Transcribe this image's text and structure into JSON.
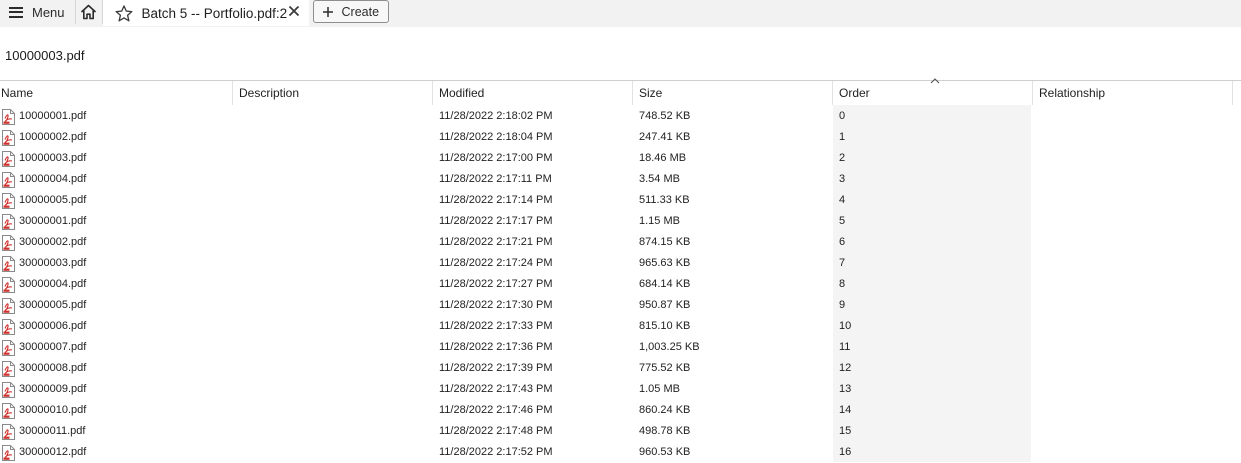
{
  "topbar": {
    "menu_label": "Menu",
    "tab_title": "Batch 5 -- Portfolio.pdf:2",
    "create_label": "Create"
  },
  "current_file": "10000003.pdf",
  "columns": {
    "name": "Name",
    "description": "Description",
    "modified": "Modified",
    "size": "Size",
    "order": "Order",
    "relationship": "Relationship"
  },
  "sort": {
    "column": "Order",
    "direction": "ascending"
  },
  "rows": [
    {
      "name": "10000001.pdf",
      "description": "",
      "modified": "11/28/2022 2:18:02 PM",
      "size": "748.52 KB",
      "order": "0",
      "relationship": ""
    },
    {
      "name": "10000002.pdf",
      "description": "",
      "modified": "11/28/2022 2:18:04 PM",
      "size": "247.41 KB",
      "order": "1",
      "relationship": ""
    },
    {
      "name": "10000003.pdf",
      "description": "",
      "modified": "11/28/2022 2:17:00 PM",
      "size": "18.46 MB",
      "order": "2",
      "relationship": ""
    },
    {
      "name": "10000004.pdf",
      "description": "",
      "modified": "11/28/2022 2:17:11 PM",
      "size": "3.54 MB",
      "order": "3",
      "relationship": ""
    },
    {
      "name": "10000005.pdf",
      "description": "",
      "modified": "11/28/2022 2:17:14 PM",
      "size": "511.33 KB",
      "order": "4",
      "relationship": ""
    },
    {
      "name": "30000001.pdf",
      "description": "",
      "modified": "11/28/2022 2:17:17 PM",
      "size": "1.15 MB",
      "order": "5",
      "relationship": ""
    },
    {
      "name": "30000002.pdf",
      "description": "",
      "modified": "11/28/2022 2:17:21 PM",
      "size": "874.15 KB",
      "order": "6",
      "relationship": ""
    },
    {
      "name": "30000003.pdf",
      "description": "",
      "modified": "11/28/2022 2:17:24 PM",
      "size": "965.63 KB",
      "order": "7",
      "relationship": ""
    },
    {
      "name": "30000004.pdf",
      "description": "",
      "modified": "11/28/2022 2:17:27 PM",
      "size": "684.14 KB",
      "order": "8",
      "relationship": ""
    },
    {
      "name": "30000005.pdf",
      "description": "",
      "modified": "11/28/2022 2:17:30 PM",
      "size": "950.87 KB",
      "order": "9",
      "relationship": ""
    },
    {
      "name": "30000006.pdf",
      "description": "",
      "modified": "11/28/2022 2:17:33 PM",
      "size": "815.10 KB",
      "order": "10",
      "relationship": ""
    },
    {
      "name": "30000007.pdf",
      "description": "",
      "modified": "11/28/2022 2:17:36 PM",
      "size": "1,003.25 KB",
      "order": "11",
      "relationship": ""
    },
    {
      "name": "30000008.pdf",
      "description": "",
      "modified": "11/28/2022 2:17:39 PM",
      "size": "775.52 KB",
      "order": "12",
      "relationship": ""
    },
    {
      "name": "30000009.pdf",
      "description": "",
      "modified": "11/28/2022 2:17:43 PM",
      "size": "1.05 MB",
      "order": "13",
      "relationship": ""
    },
    {
      "name": "30000010.pdf",
      "description": "",
      "modified": "11/28/2022 2:17:46 PM",
      "size": "860.24 KB",
      "order": "14",
      "relationship": ""
    },
    {
      "name": "30000011.pdf",
      "description": "",
      "modified": "11/28/2022 2:17:48 PM",
      "size": "498.78 KB",
      "order": "15",
      "relationship": ""
    },
    {
      "name": "30000012.pdf",
      "description": "",
      "modified": "11/28/2022 2:17:52 PM",
      "size": "960.53 KB",
      "order": "16",
      "relationship": ""
    }
  ],
  "icons": {
    "menu": "hamburger-icon",
    "home": "home-icon",
    "tab_star": "star-icon",
    "tab_close": "close-icon",
    "create": "plus-icon",
    "file": "pdf-file-icon",
    "sort": "sort-ascending-caret-icon"
  },
  "colors": {
    "topbar_bg": "#f2f2f2",
    "order_column_bg": "#f4f4f4",
    "pdf_icon_red": "#d0312d"
  }
}
